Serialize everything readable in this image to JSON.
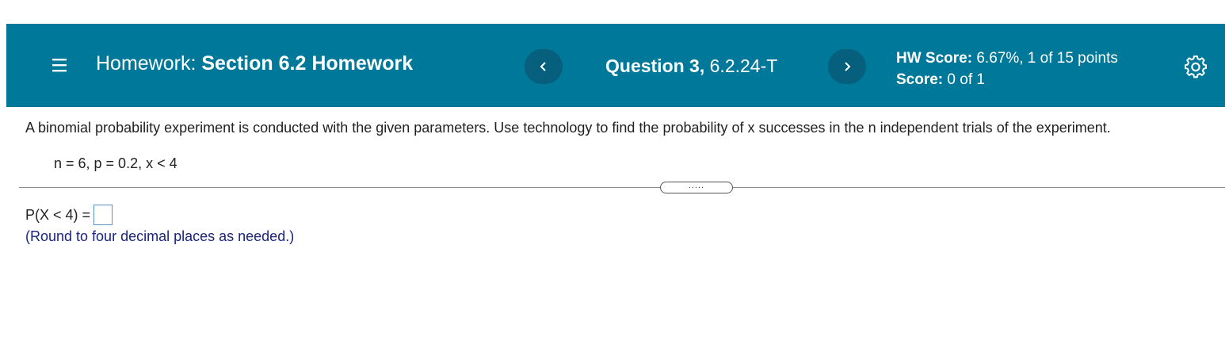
{
  "header": {
    "homework_prefix": "Homework:",
    "homework_title": "Section 6.2 Homework",
    "question_prefix": "Question 3,",
    "question_id": "6.2.24-T",
    "hw_score_label": "HW Score:",
    "hw_score_value": "6.67%, 1 of 15 points",
    "score_label": "Score:",
    "score_value": "0 of 1",
    "prev_icon": "chevron-left-icon",
    "next_icon": "chevron-right-icon",
    "menu_icon": "hamburger-menu-icon",
    "settings_icon": "gear-icon"
  },
  "question": {
    "text": "A binomial probability experiment is conducted with the given parameters. Use technology to find the probability of x successes in the n independent trials of the experiment.",
    "params": "n = 6, p = 0.2, x < 4",
    "expand_label": "....."
  },
  "answer": {
    "label": "P(X < 4) =",
    "value": "",
    "hint": "(Round to four decimal places as needed.)"
  },
  "colors": {
    "header_bg": "#00789a",
    "nav_button_bg": "#065f7d",
    "hint_text": "#1a237e",
    "input_border": "#5a8fc8"
  }
}
